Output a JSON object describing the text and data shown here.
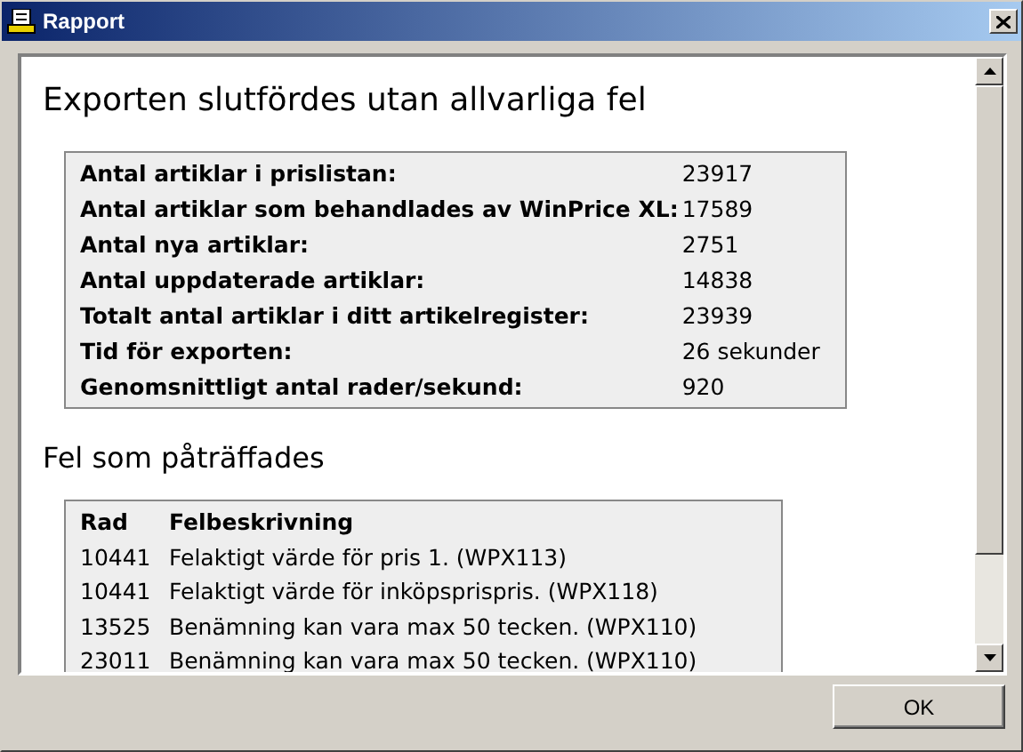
{
  "window": {
    "title": "Rapport"
  },
  "heading": "Exporten slutfördes utan allvarliga fel",
  "summary": [
    {
      "label": "Antal artiklar i prislistan:",
      "value": "23917"
    },
    {
      "label": "Antal artiklar som behandlades av WinPrice XL:",
      "value": "17589"
    },
    {
      "label": "Antal nya artiklar:",
      "value": "2751"
    },
    {
      "label": "Antal uppdaterade artiklar:",
      "value": "14838"
    },
    {
      "label": "Totalt antal artiklar i ditt artikelregister:",
      "value": "23939"
    },
    {
      "label": "Tid för exporten:",
      "value": "26 sekunder"
    },
    {
      "label": "Genomsnittligt antal rader/sekund:",
      "value": "920"
    }
  ],
  "errors_heading": "Fel som påträffades",
  "errors_table": {
    "columns": [
      "Rad",
      "Felbeskrivning"
    ],
    "rows": [
      [
        "10441",
        "Felaktigt värde för pris 1. (WPX113)"
      ],
      [
        "10441",
        "Felaktigt värde för inköpsprispris. (WPX118)"
      ],
      [
        "13525",
        "Benämning kan vara max 50 tecken. (WPX110)"
      ],
      [
        "23011",
        "Benämning kan vara max 50 tecken. (WPX110)"
      ]
    ]
  },
  "buttons": [
    "OK"
  ]
}
